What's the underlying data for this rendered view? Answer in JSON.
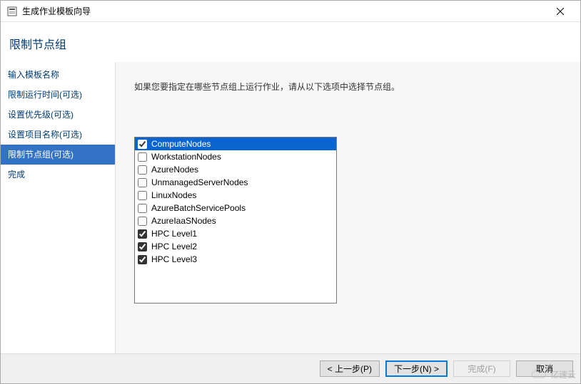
{
  "window": {
    "title": "生成作业模板向导"
  },
  "header": {
    "title": "限制节点组"
  },
  "sidebar": {
    "items": [
      {
        "label": "输入模板名称",
        "selected": false
      },
      {
        "label": "限制运行时间(可选)",
        "selected": false
      },
      {
        "label": "设置优先级(可选)",
        "selected": false
      },
      {
        "label": "设置项目名称(可选)",
        "selected": false
      },
      {
        "label": "限制节点组(可选)",
        "selected": true
      },
      {
        "label": "完成",
        "selected": false
      }
    ]
  },
  "main": {
    "instruction": "如果您要指定在哪些节点组上运行作业，请从以下选项中选择节点组。",
    "node_groups": [
      {
        "label": "ComputeNodes",
        "checked": true,
        "selected": true
      },
      {
        "label": "WorkstationNodes",
        "checked": false,
        "selected": false
      },
      {
        "label": "AzureNodes",
        "checked": false,
        "selected": false
      },
      {
        "label": "UnmanagedServerNodes",
        "checked": false,
        "selected": false
      },
      {
        "label": "LinuxNodes",
        "checked": false,
        "selected": false
      },
      {
        "label": "AzureBatchServicePools",
        "checked": false,
        "selected": false
      },
      {
        "label": "AzureIaaSNodes",
        "checked": false,
        "selected": false
      },
      {
        "label": "HPC Level1",
        "checked": true,
        "selected": false
      },
      {
        "label": "HPC Level2",
        "checked": true,
        "selected": false
      },
      {
        "label": "HPC Level3",
        "checked": true,
        "selected": false
      }
    ]
  },
  "footer": {
    "prev": "< 上一步(P)",
    "next": "下一步(N) >",
    "finish": "完成(F)",
    "cancel": "取消"
  },
  "watermark": {
    "text": "亿速云"
  }
}
